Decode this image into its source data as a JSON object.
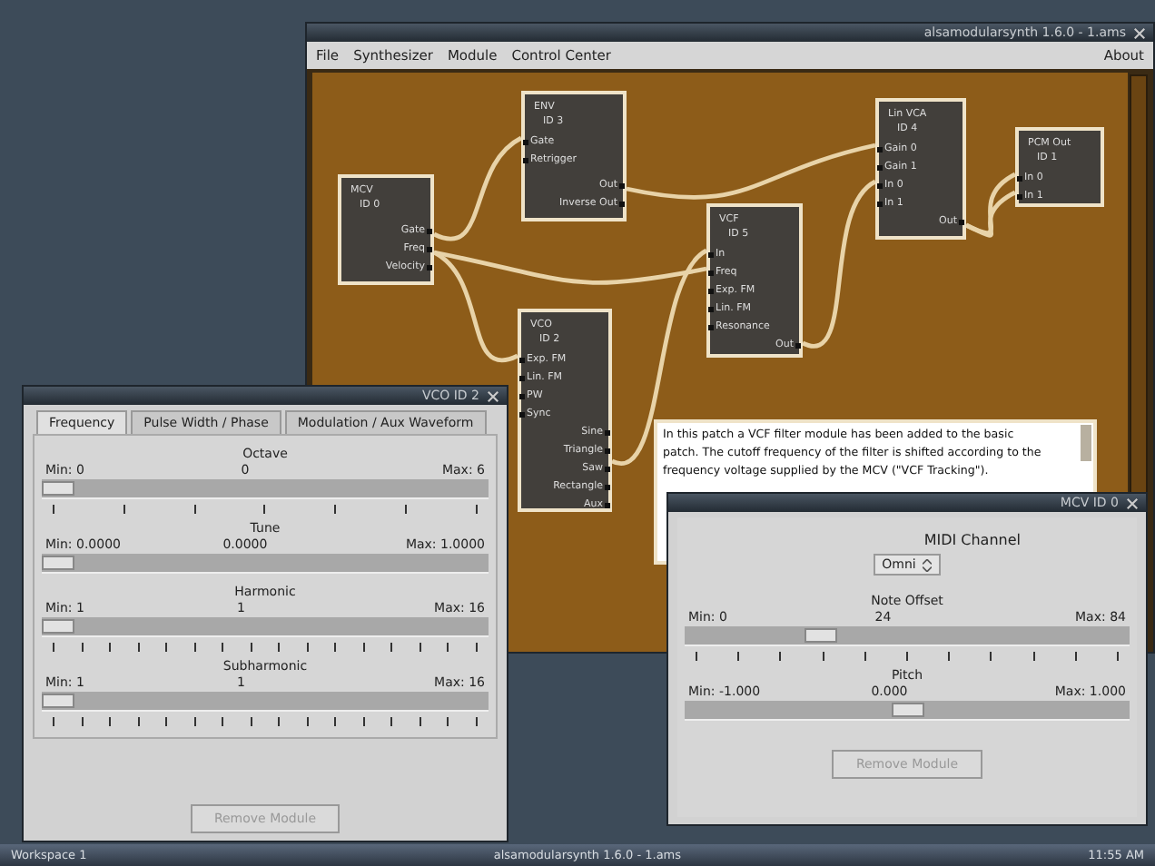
{
  "main_window": {
    "title": "alsamodularsynth 1.6.0 - 1.ams",
    "menu": [
      {
        "label": "File"
      },
      {
        "label": "Synthesizer"
      },
      {
        "label": "Module"
      },
      {
        "label": "Control Center"
      }
    ],
    "about": "About",
    "modules": [
      {
        "name": "MCV",
        "id": "ID 0",
        "outputs": [
          "Gate",
          "Freq",
          "Velocity"
        ]
      },
      {
        "name": "ENV",
        "id": "ID 3",
        "inputs": [
          "Gate",
          "Retrigger"
        ],
        "outputs": [
          "Out",
          "Inverse Out"
        ]
      },
      {
        "name": "VCO",
        "id": "ID 2",
        "inputs": [
          "Exp. FM",
          "Lin. FM",
          "PW",
          "Sync"
        ],
        "outputs": [
          "Sine",
          "Triangle",
          "Saw",
          "Rectangle",
          "Aux"
        ]
      },
      {
        "name": "VCF",
        "id": "ID 5",
        "inputs": [
          "In",
          "Freq",
          "Exp. FM",
          "Lin. FM",
          "Resonance"
        ],
        "outputs": [
          "Out"
        ]
      },
      {
        "name": "Lin VCA",
        "id": "ID 4",
        "inputs": [
          "Gain 0",
          "Gain 1",
          "In 0",
          "In 1"
        ],
        "outputs": [
          "Out"
        ]
      },
      {
        "name": "PCM Out",
        "id": "ID 1",
        "inputs": [
          "In 0",
          "In 1"
        ]
      }
    ],
    "note_lines": [
      "In this patch a VCF filter module has been added to the basic",
      "patch. The cutoff frequency of the filter is shifted according to the",
      "frequency voltage supplied by the MCV (\"VCF Tracking\")."
    ]
  },
  "vco_window": {
    "title": "VCO ID 2",
    "tabs": [
      {
        "label": "Frequency",
        "selected": true
      },
      {
        "label": "Pulse Width / Phase",
        "selected": false
      },
      {
        "label": "Modulation / Aux Waveform",
        "selected": false
      }
    ],
    "sliders": [
      {
        "label": "Octave",
        "min": "Min: 0",
        "value": "0",
        "max": "Max: 6",
        "level": 0,
        "kind": "coarse"
      },
      {
        "label": "Tune",
        "min": "Min: 0.0000",
        "value": "0.0000",
        "max": "Max: 1.0000",
        "level": 0,
        "kind": "plain"
      },
      {
        "label": "Harmonic",
        "min": "Min: 1",
        "value": "1",
        "max": "Max: 16",
        "level": 0,
        "kind": "fine"
      },
      {
        "label": "Subharmonic",
        "min": "Min: 1",
        "value": "1",
        "max": "Max: 16",
        "level": 0,
        "kind": "fine"
      }
    ],
    "button": {
      "label": "Remove Module",
      "disabled": true
    }
  },
  "mcv_window": {
    "title": "MCV ID 0",
    "midi_label": "MIDI Channel",
    "midi_value": "Omni",
    "sliders": [
      {
        "label": "Note Offset",
        "min": "Min: 0",
        "value": "24",
        "max": "Max: 84",
        "level": 0.29,
        "kind": "medium"
      },
      {
        "label": "Pitch",
        "min": "Min: -1.000",
        "value": "0.000",
        "max": "Max: 1.000",
        "level": 0.5,
        "kind": "plain"
      }
    ],
    "button": {
      "label": "Remove Module",
      "disabled": true
    }
  },
  "taskbar": {
    "workspace": "Workspace 1",
    "task": "alsamodularsynth 1.6.0 - 1.ams",
    "clock": "11:55 AM"
  }
}
